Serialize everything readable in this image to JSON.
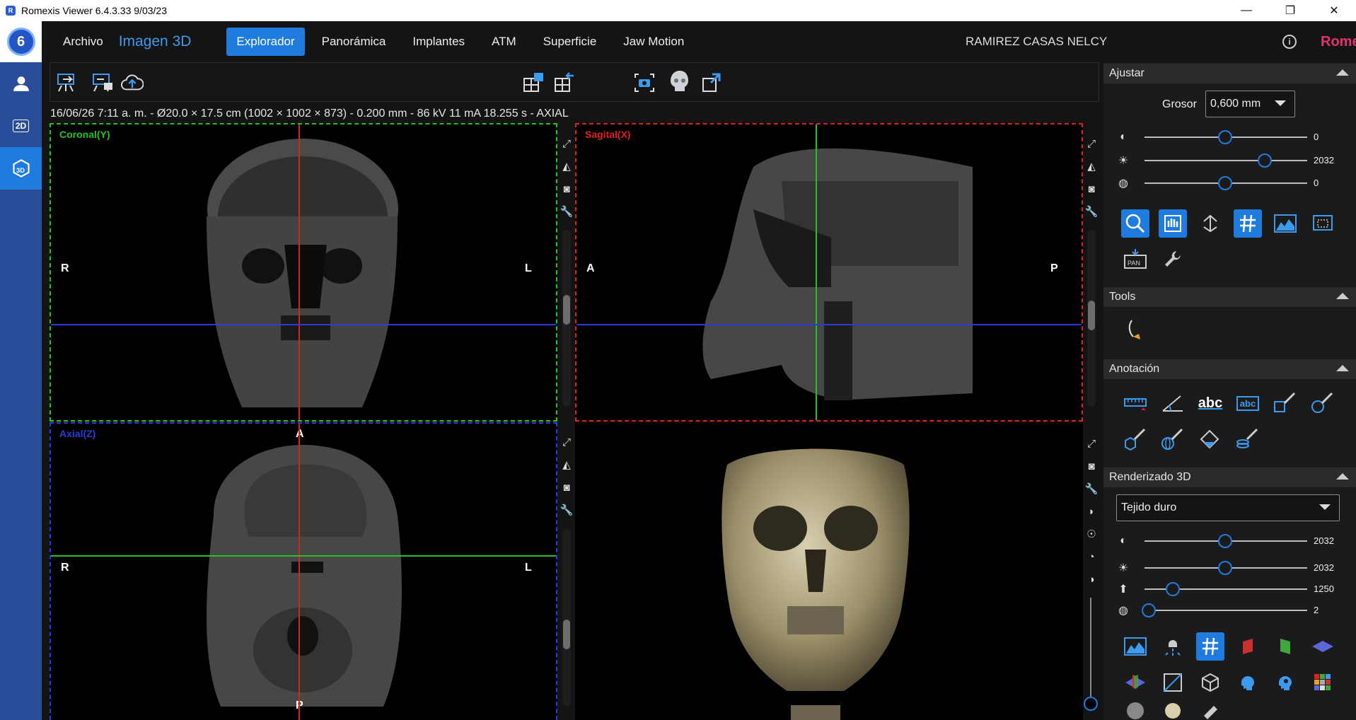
{
  "window": {
    "title": "Romexis Viewer 6.4.3.33 9/03/23",
    "controls": [
      "—",
      "❐",
      "✕"
    ]
  },
  "leftbar": {
    "logo_text": "6",
    "items": [
      {
        "name": "patient",
        "label": ""
      },
      {
        "name": "2d",
        "label": "2D"
      },
      {
        "name": "3d",
        "label": ""
      }
    ]
  },
  "menubar": {
    "archivo": "Archivo",
    "module": "Imagen 3D",
    "tabs": [
      "Explorador",
      "Panorámica",
      "Implantes",
      "ATM",
      "Superficie",
      "Jaw Motion"
    ],
    "active_tab": "Explorador",
    "patient": "RAMIREZ CASAS NELCY",
    "info": "i",
    "brand": "Romexis"
  },
  "info_line": "16/06/26 7:11 a. m. - Ø20.0 × 17.5 cm (1002 × 1002 × 873) - 0.200 mm - 86 kV 11 mA 18.255 s - AXIAL",
  "views": {
    "coronal": {
      "label": "Coronal(Y)",
      "left": "R",
      "right": "L",
      "color": "#22c322"
    },
    "sagittal": {
      "label": "Sagital(X)",
      "left": "A",
      "right": "P",
      "color": "#e0201e"
    },
    "axial": {
      "label": "Axial(Z)",
      "left": "R",
      "right": "L",
      "top": "A",
      "bottom": "P",
      "color": "#2a3bd8"
    }
  },
  "panel": {
    "ajustar": {
      "title": "Ajustar",
      "grosor_label": "Grosor",
      "grosor_value": "0,600 mm",
      "sliders": [
        {
          "icon": "contrast-icon",
          "value": "0",
          "pos": 0.5
        },
        {
          "icon": "brightness-icon",
          "value": "2032",
          "pos": 0.74
        },
        {
          "icon": "sharpness-icon",
          "value": "0",
          "pos": 0.5
        }
      ]
    },
    "tools": {
      "title": "Tools"
    },
    "anotacion": {
      "title": "Anotación",
      "abc1": "abc",
      "abc2": "abc"
    },
    "render": {
      "title": "Renderizado 3D",
      "preset": "Tejido duro",
      "sliders": [
        {
          "icon": "contrast-icon",
          "value": "2032",
          "pos": 0.49
        },
        {
          "icon": "brightness-icon",
          "value": "2032",
          "pos": 0.49
        },
        {
          "icon": "threshold-icon",
          "value": "1250",
          "pos": 0.3
        },
        {
          "icon": "opacity-icon",
          "value": "2",
          "pos": 0.2
        }
      ]
    },
    "pan_label": "PAN"
  }
}
